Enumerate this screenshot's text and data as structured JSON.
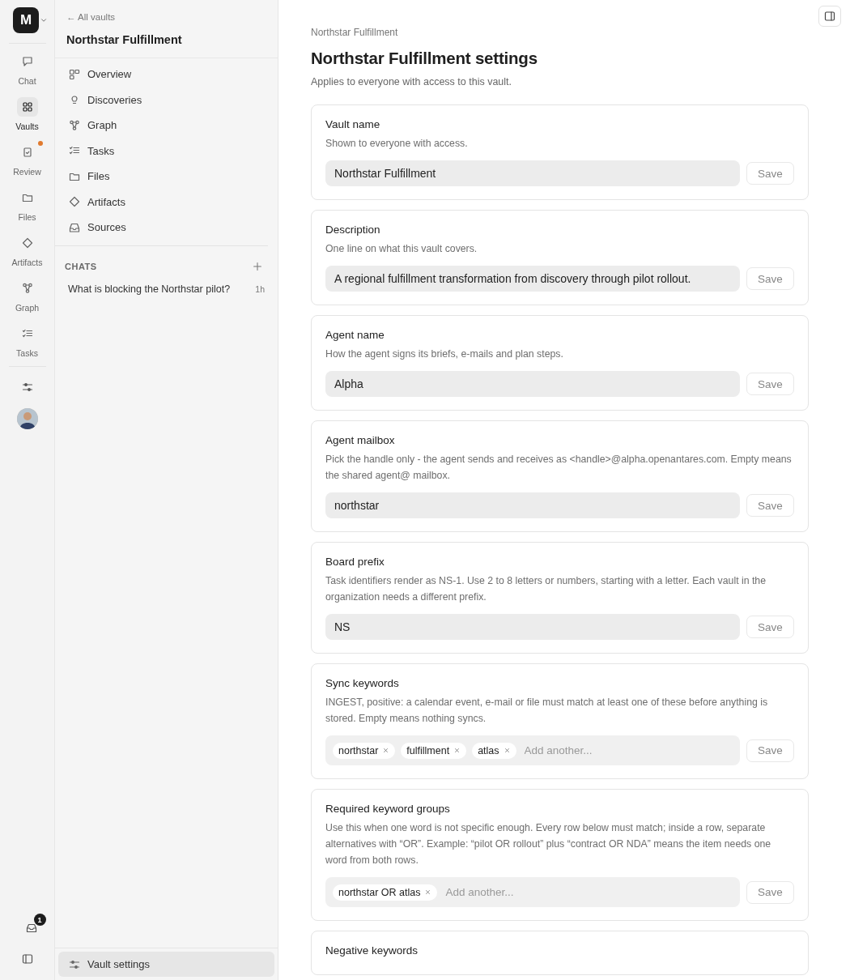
{
  "workspace": {
    "initial": "M"
  },
  "rail": {
    "items": [
      {
        "label": "Chat",
        "selected": false,
        "notify": false
      },
      {
        "label": "Vaults",
        "selected": true,
        "notify": false
      },
      {
        "label": "Review",
        "selected": false,
        "notify": true
      },
      {
        "label": "Files",
        "selected": false,
        "notify": false
      },
      {
        "label": "Artifacts",
        "selected": false,
        "notify": false
      },
      {
        "label": "Graph",
        "selected": false,
        "notify": false
      },
      {
        "label": "Tasks",
        "selected": false,
        "notify": false
      }
    ],
    "inbox_count": "1"
  },
  "sidebar": {
    "back": "← All vaults",
    "title": "Northstar Fulfillment",
    "items": [
      {
        "label": "Overview",
        "selected": false
      },
      {
        "label": "Discoveries",
        "selected": false
      },
      {
        "label": "Graph",
        "selected": false
      },
      {
        "label": "Tasks",
        "selected": false
      },
      {
        "label": "Files",
        "selected": false
      },
      {
        "label": "Artifacts",
        "selected": false
      },
      {
        "label": "Sources",
        "selected": false
      }
    ],
    "chats_heading": "CHATS",
    "chats": [
      {
        "title": "What is blocking the Northstar pilot?",
        "age": "1h"
      }
    ],
    "footer": {
      "label": "Vault settings",
      "selected": true
    }
  },
  "page": {
    "breadcrumb": "Northstar Fulfillment",
    "title": "Northstar Fulfillment settings",
    "subtitle": "Applies to everyone with access to this vault.",
    "cards": [
      {
        "title": "Vault name",
        "description": "Shown to everyone with access.",
        "kind": "text",
        "value": "Northstar Fulfillment",
        "button": "Save"
      },
      {
        "title": "Description",
        "description": "One line on what this vault covers.",
        "kind": "text",
        "value": "A regional fulfillment transformation from discovery through pilot rollout.",
        "button": "Save"
      },
      {
        "title": "Agent name",
        "description": "How the agent signs its briefs, e-mails and plan steps.",
        "kind": "text",
        "value": "Alpha",
        "button": "Save"
      },
      {
        "title": "Agent mailbox",
        "description": "Pick the handle only - the agent sends and receives as <handle>@alpha.openantares.com. Empty means the shared agent@ mailbox.",
        "kind": "text",
        "value": "northstar",
        "button": "Save"
      },
      {
        "title": "Board prefix",
        "description": "Task identifiers render as NS-1. Use 2 to 8 letters or numbers, starting with a letter. Each vault in the organization needs a different prefix.",
        "kind": "text",
        "value": "NS",
        "button": "Save"
      },
      {
        "title": "Sync keywords",
        "description": "INGEST, positive: a calendar event, e-mail or file must match at least one of these before anything is stored. Empty means nothing syncs.",
        "kind": "tags",
        "tags": [
          "northstar",
          "fulfillment",
          "atlas"
        ],
        "placeholder": "Add another...",
        "button": "Save"
      },
      {
        "title": "Required keyword groups",
        "description": "Use this when one word is not specific enough. Every row below must match; inside a row, separate alternatives with “OR”. Example: “pilot OR rollout” plus “contract OR NDA” means the item needs one word from both rows.",
        "kind": "tags",
        "tags": [
          "northstar OR atlas"
        ],
        "placeholder": "Add another...",
        "button": "Save"
      },
      {
        "title": "Negative keywords",
        "kind": "cut"
      }
    ]
  }
}
